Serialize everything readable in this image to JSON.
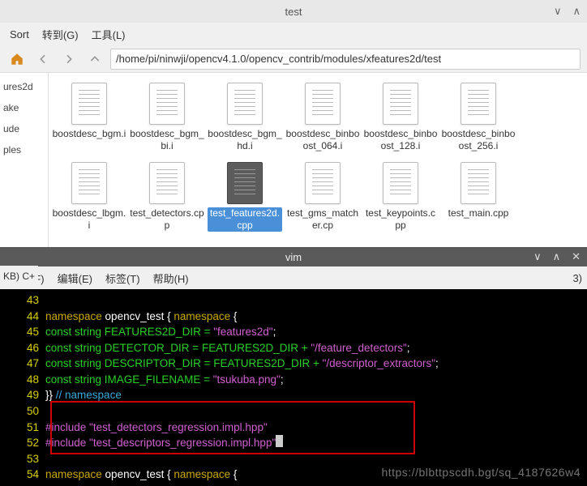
{
  "fm": {
    "title": "test",
    "menu": {
      "sort": "Sort",
      "goto": "转到(G)",
      "tools": "工具(L)"
    },
    "path": "/home/pi/ninwji/opencv4.1.0/opencv_contrib/modules/xfeatures2d/test",
    "sidebar": [
      "ures2d",
      "ake",
      "ude",
      "ples"
    ],
    "files": [
      {
        "name": "boostdesc_bgm.i",
        "sel": false
      },
      {
        "name": "boostdesc_bgm_bi.i",
        "sel": false
      },
      {
        "name": "boostdesc_bgm_hd.i",
        "sel": false
      },
      {
        "name": "boostdesc_binboost_064.i",
        "sel": false
      },
      {
        "name": "boostdesc_binboost_128.i",
        "sel": false
      },
      {
        "name": "boostdesc_binboost_256.i",
        "sel": false
      },
      {
        "name": "boostdesc_lbgm.i",
        "sel": false
      },
      {
        "name": "test_detectors.cpp",
        "sel": false
      },
      {
        "name": "test_features2d.cpp",
        "sel": true
      },
      {
        "name": "test_gms_matcher.cp",
        "sel": false
      },
      {
        "name": "test_keypoints.cpp",
        "sel": false
      },
      {
        "name": "test_main.cpp",
        "sel": false
      }
    ]
  },
  "vim": {
    "title": "vim",
    "leftlabel": "KB) C+",
    "rightlabel": "3)",
    "menu": {
      "file": "文件(F)",
      "edit": "编辑(E)",
      "tags": "标签(T)",
      "help": "帮助(H)"
    },
    "code": {
      "l43": {
        "n": "43",
        "t": ""
      },
      "l44": {
        "n": "44",
        "kw1": "namespace",
        "id1": " opencv_test { ",
        "kw2": "namespace",
        "id2": " {"
      },
      "l45": {
        "n": "45",
        "kw": "const",
        "ty": " string FEATURES2D_DIR = ",
        "lit": "\"features2d\"",
        "end": ";"
      },
      "l46": {
        "n": "46",
        "kw": "const",
        "ty": " string DETECTOR_DIR = FEATURES2D_DIR + ",
        "lit": "\"/feature_detectors\"",
        "end": ";"
      },
      "l47": {
        "n": "47",
        "kw": "const",
        "ty": " string DESCRIPTOR_DIR = FEATURES2D_DIR + ",
        "lit": "\"/descriptor_extractors\"",
        "end": ";"
      },
      "l48": {
        "n": "48",
        "kw": "const",
        "ty": " string IMAGE_FILENAME = ",
        "lit": "\"tsukuba.png\"",
        "end": ";"
      },
      "l49": {
        "n": "49",
        "br": "}} ",
        "cm": "// namespace"
      },
      "l50": {
        "n": "50",
        "t": ""
      },
      "l51": {
        "n": "51",
        "inc": "#include ",
        "lit": "\"test_detectors_regression.impl.hpp\""
      },
      "l52": {
        "n": "52",
        "inc": "#include ",
        "lit": "\"test_descriptors_regression.impl.hpp\""
      },
      "l53": {
        "n": "53",
        "t": ""
      },
      "l54": {
        "n": "54",
        "kw1": "namespace",
        "id1": " opencv_test { ",
        "kw2": "namespace",
        "id2": " {"
      }
    }
  },
  "watermark": "https://blbttpscdh.bgt/sq_4187626w4"
}
